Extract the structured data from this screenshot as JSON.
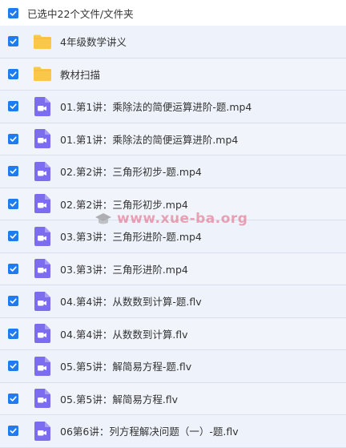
{
  "header": {
    "selected_label": "已选中22个文件/文件夹"
  },
  "files": [
    {
      "type": "folder",
      "name": "4年级数学讲义"
    },
    {
      "type": "folder",
      "name": "教材扫描"
    },
    {
      "type": "video",
      "name": "01.第1讲：乘除法的简便运算进阶-题.mp4"
    },
    {
      "type": "video",
      "name": "01.第1讲：乘除法的简便运算进阶.mp4"
    },
    {
      "type": "video",
      "name": "02.第2讲：三角形初步-题.mp4"
    },
    {
      "type": "video",
      "name": "02.第2讲：三角形初步.mp4"
    },
    {
      "type": "video",
      "name": "03.第3讲：三角形进阶-题.mp4"
    },
    {
      "type": "video",
      "name": "03.第3讲：三角形进阶.mp4"
    },
    {
      "type": "video",
      "name": "04.第4讲：从数数到计算-题.flv"
    },
    {
      "type": "video",
      "name": "04.第4讲：从数数到计算.flv"
    },
    {
      "type": "video",
      "name": "05.第5讲：解简易方程-题.flv"
    },
    {
      "type": "video",
      "name": "05.第5讲：解简易方程.flv"
    },
    {
      "type": "video",
      "name": "06第6讲：列方程解决问题（一）-题.flv"
    }
  ],
  "watermark": {
    "text": "www.xue-ba.org"
  },
  "colors": {
    "accent": "#1f7cf0",
    "folder": "#f9c84a",
    "video": "#7b6cf0"
  }
}
